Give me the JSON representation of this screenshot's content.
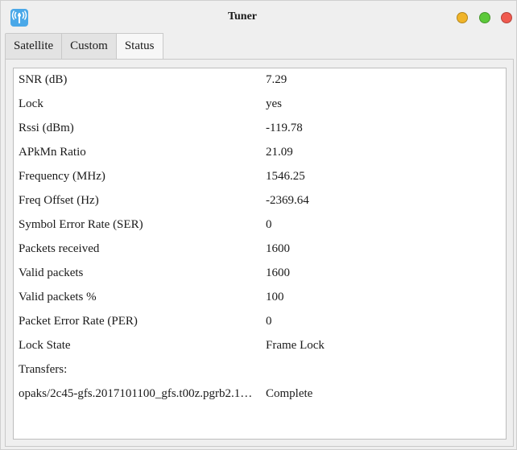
{
  "window": {
    "title": "Tuner",
    "buttons": {
      "minimize_color": "#f0b429",
      "maximize_color": "#5cc93a",
      "close_color": "#f05a4f"
    },
    "icon": "tuner-app-icon"
  },
  "tabs": [
    {
      "label": "Satellite",
      "active": false
    },
    {
      "label": "Custom",
      "active": false
    },
    {
      "label": "Status",
      "active": true
    }
  ],
  "status": {
    "rows": [
      {
        "key": "SNR (dB)",
        "value": "7.29"
      },
      {
        "key": "Lock",
        "value": "yes"
      },
      {
        "key": "Rssi (dBm)",
        "value": "-119.78"
      },
      {
        "key": "APkMn Ratio",
        "value": "21.09"
      },
      {
        "key": "Frequency (MHz)",
        "value": "1546.25"
      },
      {
        "key": "Freq Offset (Hz)",
        "value": "-2369.64"
      },
      {
        "key": "Symbol Error Rate (SER)",
        "value": "0"
      },
      {
        "key": "Packets received",
        "value": "1600"
      },
      {
        "key": "Valid packets",
        "value": "1600"
      },
      {
        "key": "Valid packets %",
        "value": "100"
      },
      {
        "key": "Packet Error Rate (PER)",
        "value": "0"
      },
      {
        "key": "Lock State",
        "value": "Frame Lock"
      },
      {
        "key": "Transfers:",
        "value": ""
      },
      {
        "key": "opaks/2c45-gfs.2017101100_gfs.t00z.pgrb2.1…",
        "value": "Complete"
      }
    ]
  }
}
